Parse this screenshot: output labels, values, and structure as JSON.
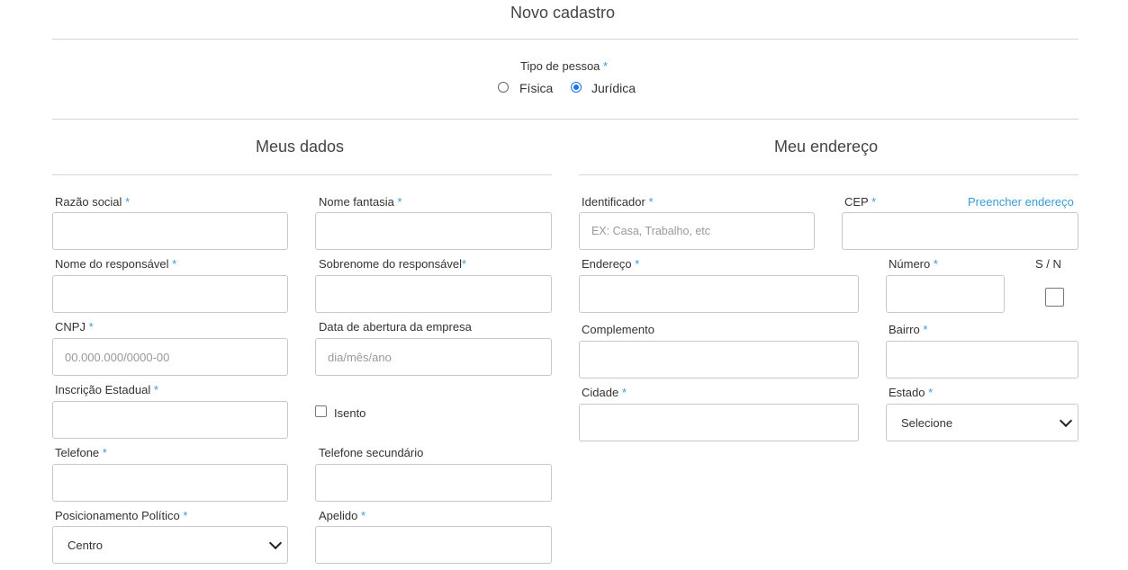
{
  "page": {
    "title": "Novo cadastro"
  },
  "person_type": {
    "label": "Tipo de pessoa",
    "required_mark": "*",
    "options": [
      {
        "label": "Física",
        "selected": false
      },
      {
        "label": "Jurídica",
        "selected": true
      }
    ]
  },
  "my_data": {
    "heading": "Meus dados",
    "razao_social": {
      "label": "Razão social",
      "required_mark": "*",
      "value": ""
    },
    "nome_fantasia": {
      "label": "Nome fantasia",
      "required_mark": "*",
      "value": ""
    },
    "nome_responsavel": {
      "label": "Nome do responsável",
      "required_mark": "*",
      "value": ""
    },
    "sobrenome_responsavel": {
      "label": "Sobrenome do responsável",
      "required_mark": "*",
      "value": ""
    },
    "cnpj": {
      "label": "CNPJ",
      "required_mark": "*",
      "placeholder": "00.000.000/0000-00"
    },
    "data_abertura": {
      "label": "Data de abertura da empresa",
      "placeholder": "dia/mês/ano"
    },
    "inscricao_estadual": {
      "label": "Inscrição Estadual",
      "required_mark": "*",
      "value": ""
    },
    "isento": {
      "label": "Isento",
      "checked": false
    },
    "telefone": {
      "label": "Telefone",
      "required_mark": "*",
      "value": ""
    },
    "telefone_secundario": {
      "label": "Telefone secundário",
      "value": ""
    },
    "posicionamento": {
      "label": "Posicionamento Político",
      "required_mark": "*",
      "selected": "Centro"
    },
    "apelido": {
      "label": "Apelido",
      "required_mark": "*",
      "value": ""
    }
  },
  "address": {
    "heading": "Meu endereço",
    "identificador": {
      "label": "Identificador",
      "required_mark": "*",
      "placeholder": "EX: Casa, Trabalho, etc"
    },
    "cep": {
      "label": "CEP",
      "required_mark": "*",
      "value": ""
    },
    "fill_link": "Preencher endereço",
    "endereco": {
      "label": "Endereço",
      "required_mark": "*",
      "value": ""
    },
    "numero": {
      "label": "Número",
      "required_mark": "*",
      "value": ""
    },
    "sn": {
      "label": "S / N",
      "checked": false
    },
    "complemento": {
      "label": "Complemento",
      "value": ""
    },
    "bairro": {
      "label": "Bairro",
      "required_mark": "*",
      "value": ""
    },
    "cidade": {
      "label": "Cidade",
      "required_mark": "*",
      "value": ""
    },
    "estado": {
      "label": "Estado",
      "required_mark": "*",
      "selected": "Selecione"
    }
  }
}
